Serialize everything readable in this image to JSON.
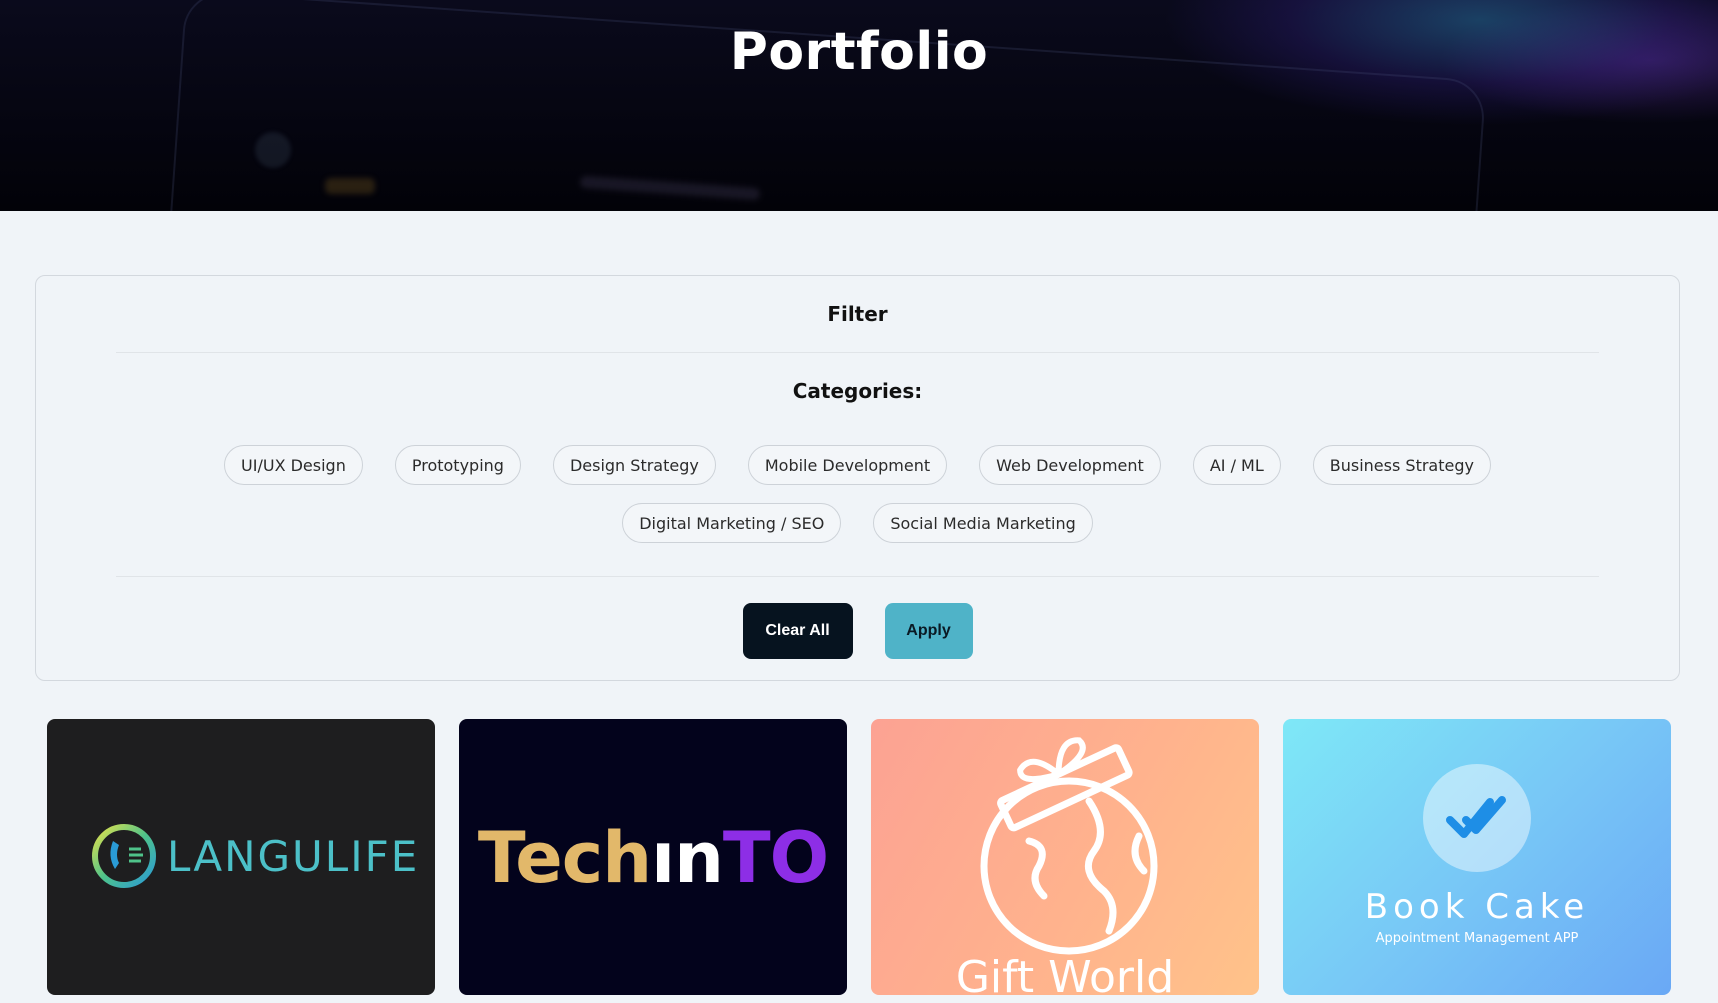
{
  "hero": {
    "title": "Portfolio"
  },
  "filter": {
    "title": "Filter",
    "categories_title": "Categories:",
    "categories_row1": [
      "UI/UX Design",
      "Prototyping",
      "Design Strategy",
      "Mobile Development",
      "Web Development",
      "AI / ML",
      "Business Strategy"
    ],
    "categories_row2": [
      "Digital Marketing / SEO",
      "Social Media Marketing"
    ],
    "clear_label": "Clear All",
    "apply_label": "Apply"
  },
  "projects": [
    {
      "name": "LANGULIFE",
      "bg": "#1e1e1f",
      "accent": "#4cc0c8"
    },
    {
      "name_parts": [
        "Tech",
        "ın",
        "TO"
      ],
      "bg": "#03031c",
      "colors": [
        "#e2b86a",
        "#ffffff",
        "#8d2ee6"
      ]
    },
    {
      "name": "Gift World",
      "bg": "#fca293"
    },
    {
      "name": "Book Cake",
      "subtitle": "Appointment Management APP",
      "bg": "#7ee8f7"
    }
  ],
  "colors": {
    "clear_btn": "#06131f",
    "apply_btn": "#4fb3c8",
    "page_bg": "#f0f4f8"
  }
}
